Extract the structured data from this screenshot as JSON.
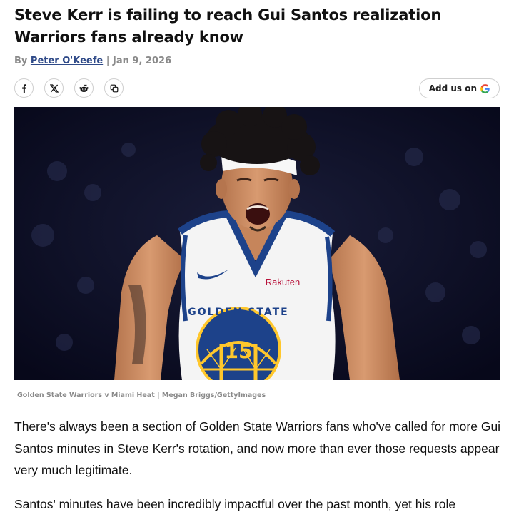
{
  "article": {
    "headline": "Steve Kerr is failing to reach Gui Santos realization Warriors fans already know",
    "byline_prefix": "By",
    "author": "Peter O'Keefe",
    "separator": "|",
    "date": "Jan 9, 2026"
  },
  "share": {
    "buttons": [
      {
        "name": "facebook",
        "icon": "facebook-icon"
      },
      {
        "name": "x",
        "icon": "x-icon"
      },
      {
        "name": "reddit",
        "icon": "reddit-icon"
      },
      {
        "name": "copy-link",
        "icon": "copy-icon"
      }
    ],
    "add_us_label": "Add us on",
    "add_us_brand_icon": "google-g-icon"
  },
  "hero_image": {
    "jersey_text": "GOLDEN STATE",
    "jersey_number": "15",
    "sponsor": "Rakuten",
    "caption": "Golden State Warriors v Miami Heat | Megan Briggs/GettyImages"
  },
  "body": {
    "paragraphs": [
      "There's always been a section of Golden State Warriors fans who've called for more Gui Santos minutes in Steve Kerr's rotation, and now more than ever those requests appear very much legitimate.",
      "Santos' minutes have been incredibly impactful over the past month, yet his role"
    ]
  },
  "colors": {
    "author_link": "#2f4a88",
    "muted_text": "#8a8a8a",
    "jersey_blue": "#1d428a",
    "jersey_gold": "#ffc72c",
    "background_dark": "#0b0d1f"
  }
}
